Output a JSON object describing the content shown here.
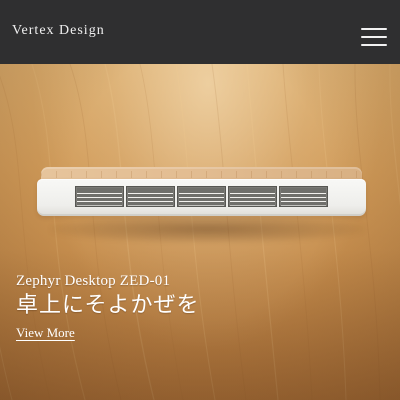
{
  "header": {
    "brand": "Vertex Design",
    "menu_icon": "hamburger-menu-icon"
  },
  "hero": {
    "product_name": "Zephyr Desktop ZED-01",
    "tagline": "卓上にそよかぜを",
    "cta_label": "View More"
  },
  "colors": {
    "header_bg": "#2f2f30",
    "header_text": "#f0f0f0",
    "wood_light": "#d9aa6a",
    "wood_dark": "#b87b3f",
    "device_body": "#f2f2ef",
    "device_top": "#e3bd92",
    "vent_dark": "#6f6f6b",
    "text": "#ffffff"
  },
  "icons": {
    "menu": "hamburger-menu-icon"
  }
}
